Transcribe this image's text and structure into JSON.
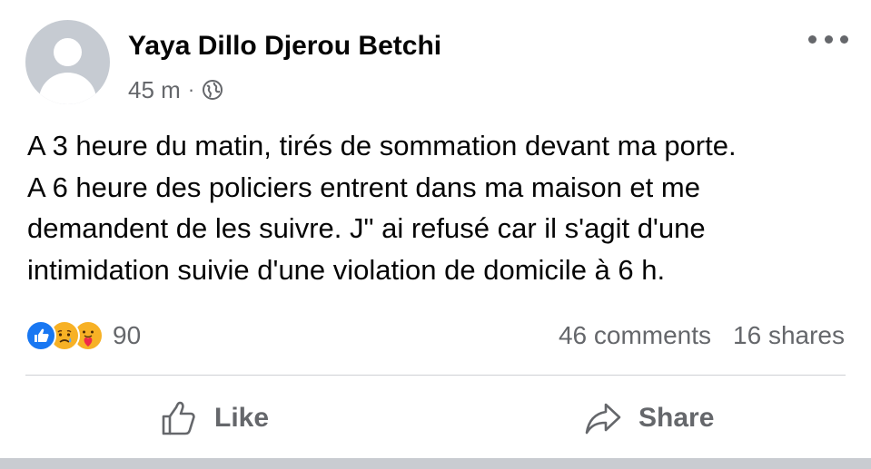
{
  "post": {
    "author": "Yaya Dillo Djerou Betchi",
    "time": "45 m",
    "separator": "·",
    "privacy_icon": "globe-icon",
    "more_icon": "more-options-icon",
    "text_lines": [
      "A 3 heure du matin, tirés de sommation devant ma porte.",
      "A 6 heure des policiers entrent dans ma maison et me",
      "demandent de les suivre. J\" ai refusé car il s'agit d'une",
      "intimidation suivie d'une violation de domicile à 6 h."
    ]
  },
  "reactions": {
    "icons": [
      "like-reaction-icon",
      "sad-reaction-icon",
      "care-reaction-icon"
    ],
    "count": "90"
  },
  "stats": {
    "comments": "46 comments",
    "shares": "16 shares"
  },
  "actions": {
    "like_label": "Like",
    "share_label": "Share"
  },
  "colors": {
    "text": "#050505",
    "secondary": "#65676b",
    "like_blue": "#1877f2",
    "reaction_yellow": "#f7b125",
    "divider": "#ced0d4"
  }
}
